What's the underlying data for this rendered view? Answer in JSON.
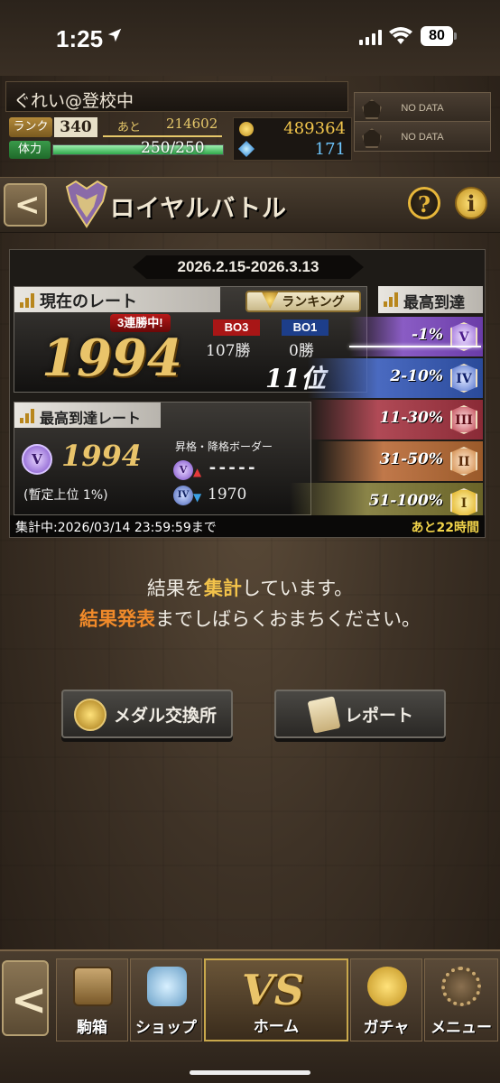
{
  "status_bar": {
    "time": "1:25",
    "battery": "80"
  },
  "player": {
    "name": "ぐれい@登校中",
    "rank_label": "ランク",
    "rank": "340",
    "ato_label": "あと",
    "ato_value": "214602",
    "hp_label": "体力",
    "hp_text": "250/250",
    "hp_fraction": 1.0,
    "coins": "489364",
    "gems": "171"
  },
  "nodata": [
    "NO DATA",
    "NO DATA"
  ],
  "title_bar": {
    "title": "ロイヤルバトル",
    "help": "?",
    "info": "i"
  },
  "panel": {
    "period": "2026.2.15-2026.3.13",
    "current_rate_label": "現在のレート",
    "ranking_button": "ランキング",
    "streak": "3連勝中!",
    "current_rate": "1994",
    "bo3_label": "BO3",
    "bo1_label": "BO1",
    "bo3_wins": "107勝",
    "bo1_wins": "0勝",
    "place": "11位",
    "best_rate_label": "最高到達レート",
    "best_badge": "V",
    "best_rate": "1994",
    "provisional": "(暫定上位 1%)",
    "border_title": "昇格・降格ボーダー",
    "border_up_badge": "V",
    "border_up": "-----",
    "border_down_badge": "IV",
    "border_down": "1970",
    "tiers_label": "最高到達",
    "tiers": [
      {
        "range": "-1%",
        "badge": "V"
      },
      {
        "range": "2-10%",
        "badge": "IV"
      },
      {
        "range": "11-30%",
        "badge": "III"
      },
      {
        "range": "31-50%",
        "badge": "II"
      },
      {
        "range": "51-100%",
        "badge": "I"
      }
    ],
    "footer_left": "集計中:2026/03/14 23:59:59まで",
    "footer_right": "あと22時間"
  },
  "message": {
    "line1_a": "結果を",
    "line1_b": "集計",
    "line1_c": "しています。",
    "line2_a": "結果発表",
    "line2_b": "までしばらくおまちください。"
  },
  "buttons": {
    "medal": "メダル交換所",
    "report": "レポート"
  },
  "nav": {
    "koma": "駒箱",
    "shop": "ショップ",
    "vs": "VS",
    "home": "ホーム",
    "gacha": "ガチャ",
    "menu": "メニュー"
  },
  "colors": {
    "gold": "#e9c46a",
    "accent_orange": "#f08a2a",
    "panel": "#1e1b17"
  }
}
